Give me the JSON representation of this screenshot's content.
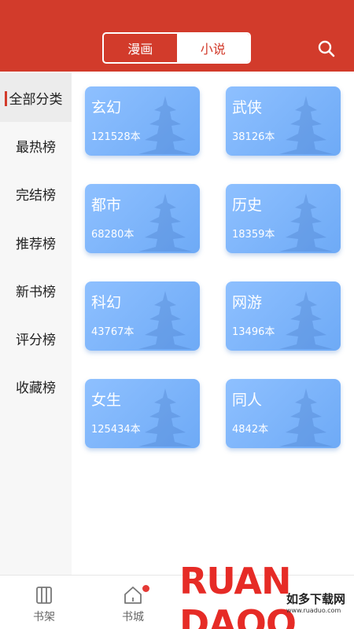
{
  "header": {
    "tabs": [
      {
        "label": "漫画",
        "active": false
      },
      {
        "label": "小说",
        "active": true
      }
    ],
    "search_icon": "search-icon"
  },
  "sidebar": {
    "items": [
      {
        "label": "全部分类",
        "active": true
      },
      {
        "label": "最热榜",
        "active": false
      },
      {
        "label": "完结榜",
        "active": false
      },
      {
        "label": "推荐榜",
        "active": false
      },
      {
        "label": "新书榜",
        "active": false
      },
      {
        "label": "评分榜",
        "active": false
      },
      {
        "label": "收藏榜",
        "active": false
      }
    ]
  },
  "categories": [
    {
      "name": "玄幻",
      "count": "121528本"
    },
    {
      "name": "武侠",
      "count": "38126本"
    },
    {
      "name": "都市",
      "count": "68280本"
    },
    {
      "name": "历史",
      "count": "18359本"
    },
    {
      "name": "科幻",
      "count": "43767本"
    },
    {
      "name": "网游",
      "count": "13496本"
    },
    {
      "name": "女生",
      "count": "125434本"
    },
    {
      "name": "同人",
      "count": "4842本"
    }
  ],
  "bottom_nav": {
    "items": [
      {
        "label": "书架",
        "icon": "bookshelf-icon"
      },
      {
        "label": "书城",
        "icon": "home-icon",
        "badge": true
      }
    ]
  },
  "watermark": {
    "brand": "RUAN DAOO",
    "sub": "如多下载网",
    "url": "www.ruaduo.com"
  },
  "colors": {
    "primary": "#d23b2b",
    "card": "#7eb5fb",
    "badge": "#e53935"
  }
}
